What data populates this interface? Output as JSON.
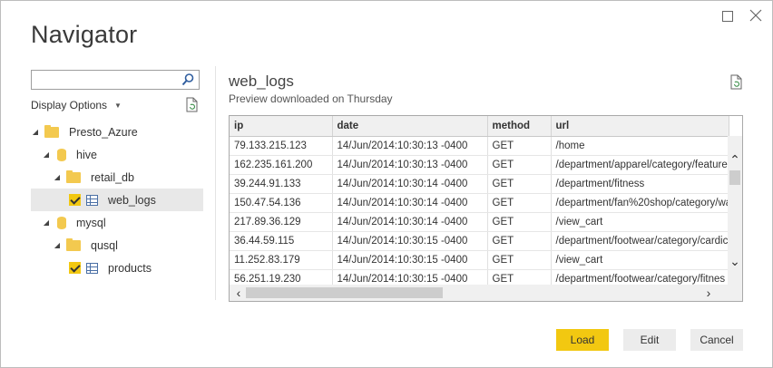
{
  "window": {
    "title": "Navigator"
  },
  "search": {
    "value": "",
    "placeholder": ""
  },
  "display_options": {
    "label": "Display Options"
  },
  "tree": [
    {
      "label": "Presto_Azure",
      "icon": "folder-icon",
      "level": 0,
      "expanded": true
    },
    {
      "label": "hive",
      "icon": "database-icon",
      "level": 1,
      "expanded": true
    },
    {
      "label": "retail_db",
      "icon": "folder-icon",
      "level": 2,
      "expanded": true
    },
    {
      "label": "web_logs",
      "icon": "table-icon",
      "level": 3,
      "checked": true,
      "selected": true
    },
    {
      "label": "mysql",
      "icon": "database-icon",
      "level": 1,
      "expanded": true
    },
    {
      "label": "qusql",
      "icon": "folder-icon",
      "level": 2,
      "expanded": true
    },
    {
      "label": "products",
      "icon": "table-icon",
      "level": 3,
      "checked": true,
      "selected": false
    }
  ],
  "preview": {
    "title": "web_logs",
    "subtitle": "Preview downloaded on Thursday",
    "columns": [
      "ip",
      "date",
      "method",
      "url"
    ],
    "rows": [
      [
        "79.133.215.123",
        "14/Jun/2014:10:30:13 -0400",
        "GET",
        "/home"
      ],
      [
        "162.235.161.200",
        "14/Jun/2014:10:30:13 -0400",
        "GET",
        "/department/apparel/category/feature"
      ],
      [
        "39.244.91.133",
        "14/Jun/2014:10:30:14 -0400",
        "GET",
        "/department/fitness"
      ],
      [
        "150.47.54.136",
        "14/Jun/2014:10:30:14 -0400",
        "GET",
        "/department/fan%20shop/category/wa"
      ],
      [
        "217.89.36.129",
        "14/Jun/2014:10:30:14 -0400",
        "GET",
        "/view_cart"
      ],
      [
        "36.44.59.115",
        "14/Jun/2014:10:30:15 -0400",
        "GET",
        "/department/footwear/category/cardic"
      ],
      [
        "11.252.83.179",
        "14/Jun/2014:10:30:15 -0400",
        "GET",
        "/view_cart"
      ],
      [
        "56.251.19.230",
        "14/Jun/2014:10:30:15 -0400",
        "GET",
        "/department/footwear/category/fitnes"
      ]
    ]
  },
  "buttons": {
    "load": "Load",
    "edit": "Edit",
    "cancel": "Cancel"
  },
  "colors": {
    "accent": "#f2c811",
    "folder": "#f3c94f",
    "table_icon": "#4a6fa5"
  }
}
